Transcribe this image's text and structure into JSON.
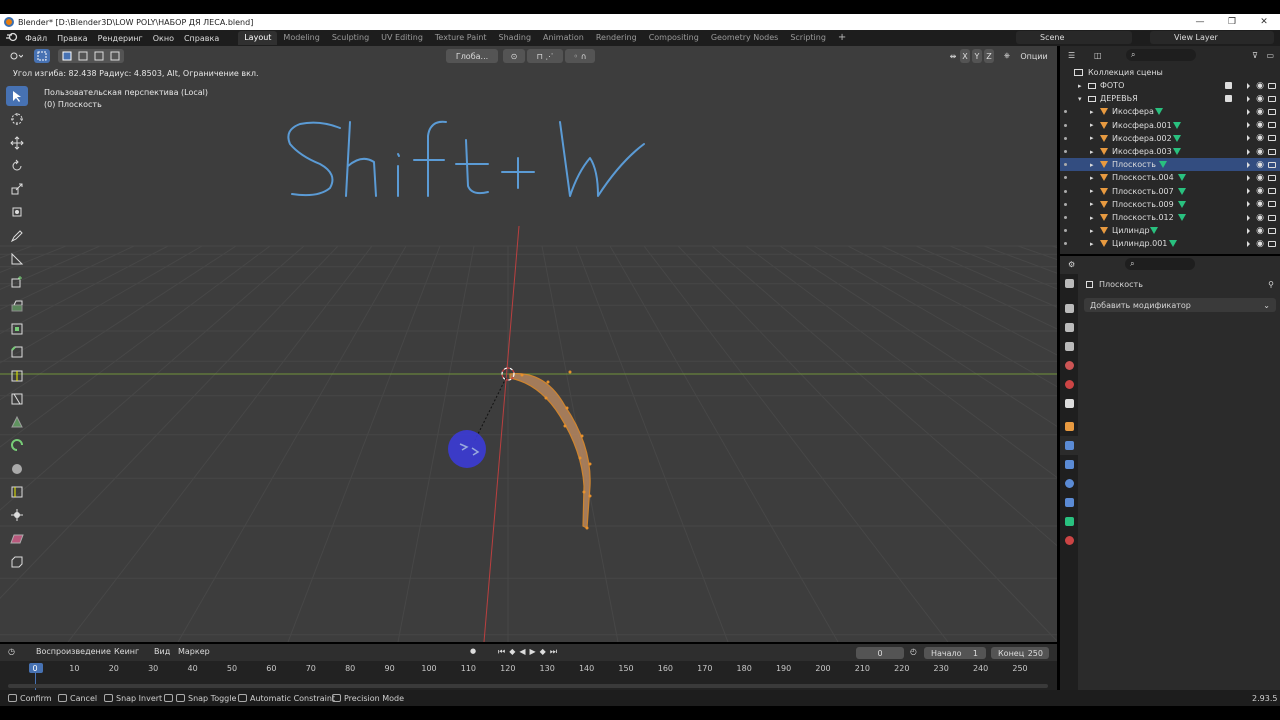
{
  "window": {
    "title": "Blender* [D:\\Blender3D\\LOW POLY\\НАБОР ДЯ ЛЕСА.blend]",
    "minimize": "—",
    "maximize": "❐",
    "close": "✕"
  },
  "menu": {
    "file": "Файл",
    "edit": "Правка",
    "render": "Рендеринг",
    "window": "Окно",
    "help": "Справка"
  },
  "workspaces": [
    "Layout",
    "Modeling",
    "Sculpting",
    "UV Editing",
    "Texture Paint",
    "Shading",
    "Animation",
    "Rendering",
    "Compositing",
    "Geometry Nodes",
    "Scripting"
  ],
  "scene": "Scene",
  "view_layer": "View Layer",
  "viewport": {
    "transform_orientation": "Глоба...",
    "options": "Опции",
    "axes": [
      "X",
      "Y",
      "Z"
    ],
    "operator_hint": "Угол изгиба: 82.438 Радиус: 4.8503, Alt, Ограничение вкл.",
    "perspective": "Пользовательская перспектива (Local)",
    "object_label": "(0) Плоскость",
    "annotation": "Shift+W"
  },
  "outliner": {
    "root": "Коллекция сцены",
    "items": [
      {
        "name": "ФОТО",
        "type": "collection",
        "level": 1
      },
      {
        "name": "ДЕРЕВЬЯ",
        "type": "collection",
        "level": 1
      },
      {
        "name": "Икосфера",
        "type": "mesh",
        "level": 2
      },
      {
        "name": "Икосфера.001",
        "type": "mesh",
        "level": 2
      },
      {
        "name": "Икосфера.002",
        "type": "mesh",
        "level": 2
      },
      {
        "name": "Икосфера.003",
        "type": "mesh",
        "level": 2
      },
      {
        "name": "Плоскость",
        "type": "mesh",
        "level": 2,
        "selected": true
      },
      {
        "name": "Плоскость.004",
        "type": "mesh",
        "level": 2
      },
      {
        "name": "Плоскость.007",
        "type": "mesh",
        "level": 2
      },
      {
        "name": "Плоскость.009",
        "type": "mesh",
        "level": 2
      },
      {
        "name": "Плоскость.012",
        "type": "mesh",
        "level": 2
      },
      {
        "name": "Цилиндр",
        "type": "mesh",
        "level": 2
      },
      {
        "name": "Цилиндр.001",
        "type": "mesh",
        "level": 2
      }
    ]
  },
  "properties": {
    "object_name": "Плоскость",
    "add_modifier": "Добавить модификатор"
  },
  "timeline": {
    "playback": "Воспроизведение",
    "keying": "Кеинг",
    "view": "Вид",
    "marker": "Маркер",
    "current_frame": "0",
    "start_label": "Начало",
    "start": "1",
    "end_label": "Конец",
    "end": "250",
    "ticks": [
      "0",
      "10",
      "20",
      "30",
      "40",
      "50",
      "60",
      "70",
      "80",
      "90",
      "100",
      "110",
      "120",
      "130",
      "140",
      "150",
      "160",
      "170",
      "180",
      "190",
      "200",
      "210",
      "220",
      "230",
      "240",
      "250"
    ]
  },
  "statusbar": {
    "confirm": "Confirm",
    "cancel": "Cancel",
    "snap_invert": "Snap Invert",
    "snap_toggle": "Snap Toggle",
    "auto_constraint": "Automatic Constraint",
    "precision": "Precision Mode",
    "version": "2.93.5"
  },
  "colors": {
    "accent": "#4772b3",
    "selection": "#e8912c",
    "annotation": "#5b9bd5",
    "x_axis": "#d04040",
    "y_axis": "#7ea83a"
  }
}
